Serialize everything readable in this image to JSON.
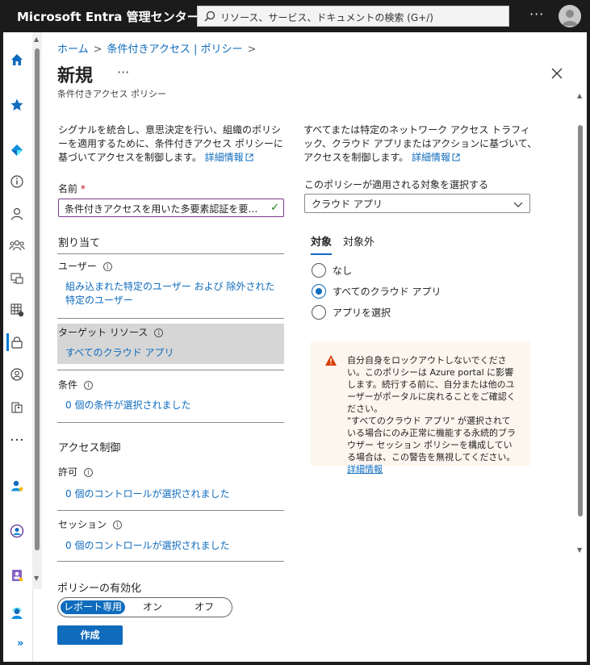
{
  "app": {
    "title": "Microsoft Entra 管理センター"
  },
  "search": {
    "placeholder": "リソース、サービス、ドキュメントの検索 (G+/)"
  },
  "topbar": {
    "more": "···"
  },
  "breadcrumb": [
    "ホーム",
    "条件付きアクセス | ポリシー"
  ],
  "page": {
    "title": "新規",
    "more": "···",
    "subtitle": "条件付きアクセス ポリシー",
    "description": "シグナルを統合し、意思決定を行い、組織のポリシーを適用するために、条件付きアクセス ポリシーに基づいてアクセスを制御します。",
    "learn_more": "詳細情報"
  },
  "name_field": {
    "label": "名前",
    "required_mark": "*",
    "value": "条件付きアクセスを用いた多要素認証を要求するポリシー"
  },
  "assignments": {
    "heading": "割り当て",
    "users_label": "ユーザー",
    "users_value": "組み込まれた特定のユーザー および 除外された特定のユーザー",
    "target_label": "ターゲット リソース",
    "target_value": "すべてのクラウド アプリ",
    "conditions_label": "条件",
    "conditions_value": "0 個の条件が選択されました"
  },
  "access_controls": {
    "heading": "アクセス制御",
    "grant_label": "許可",
    "grant_value": "0 個のコントロールが選択されました",
    "session_label": "セッション",
    "session_value": "0 個のコントロールが選択されました"
  },
  "right": {
    "description": "すべてまたは特定のネットワーク アクセス トラフィック、クラウド アプリまたはアクションに基づいて、アクセスを制御します。",
    "learn_more": "詳細情報",
    "select_label": "このポリシーが適用される対象を選択する",
    "select_value": "クラウド アプリ",
    "tabs": [
      "対象",
      "対象外"
    ],
    "radios": [
      "なし",
      "すべてのクラウド アプリ",
      "アプリを選択"
    ],
    "selected_radio": 1,
    "warning": "自分自身をロックアウトしないでください。このポリシーは Azure portal に影響します。続行する前に、自分または他のユーザーがポータルに戻れることをご確認ください。\n\"すべてのクラウド アプリ\" が選択されている場合にのみ正常に機能する永続的ブラウザー セッション ポリシーを構成している場合は、この警告を無視してください。",
    "warning_link": "詳細情報"
  },
  "enable_policy": {
    "label": "ポリシーの有効化",
    "options": [
      "レポート専用",
      "オン",
      "オフ"
    ],
    "selected": "レポート専用"
  },
  "create_button": "作成",
  "colors": {
    "accent": "#0f6cbd",
    "warning": "#d83b01",
    "topbar": "#1b1b1b"
  }
}
